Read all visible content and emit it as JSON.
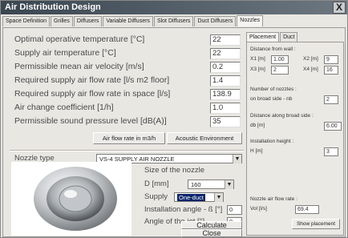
{
  "window": {
    "title": "Air Distribution Design",
    "close_label": "X"
  },
  "tabs": [
    {
      "label": "Space Definition"
    },
    {
      "label": "Grilles"
    },
    {
      "label": "Diffusers"
    },
    {
      "label": "Variable Diffusers"
    },
    {
      "label": "Slot Diffusers"
    },
    {
      "label": "Duct Diffusers"
    },
    {
      "label": "Nozzles",
      "active": true
    }
  ],
  "params": [
    {
      "label": "Optimal operative temperature  [°C]",
      "value": "22"
    },
    {
      "label": "Supply air temperature  [°C]",
      "value": "22"
    },
    {
      "label": "Permissible mean air velocity  [m/s]",
      "value": "0.2"
    },
    {
      "label": "Required supply air flow rate  [l/s m2 floor]",
      "value": "1.4"
    },
    {
      "label": "Required supply air flow rate in space  [l/s]",
      "value": "138.9"
    },
    {
      "label": "Air change coefficient  [1/h]",
      "value": "1.0"
    },
    {
      "label": "Permissible sound pressure level  [dB(A)]",
      "value": "35"
    }
  ],
  "buttons": {
    "airflow": "Air flow rate in m3/h",
    "acoustic": "Acoustic Environment",
    "calculate": "Calculate",
    "close": "Close",
    "show_placement": "Show placement"
  },
  "nozzle_type": {
    "label": "Nozzle type",
    "value": "VS-4  SUPPLY AIR NOZZLE"
  },
  "size": {
    "title": "Size of the nozzle",
    "d_label": "D   [mm]",
    "d_value": "160",
    "supply_label": "Supply",
    "supply_value": "One-duct",
    "angle_label": "Installation angle - ß   [°]",
    "angle_value": "0",
    "jet_label": "Angle of the jet  [°]",
    "jet_value": "0"
  },
  "right": {
    "tabs": [
      "Placement",
      "Duct"
    ],
    "distance_wall": "Distance from wall :",
    "x1_label": "X1  [m]",
    "x1_value": "1.00",
    "x2_label": "X2  [m]",
    "x2_value": "9",
    "x3_label": "X3  [m]",
    "x3_value": "2",
    "x4_label": "X4  [m]",
    "x4_value": "16",
    "num_nozzles": "Number of nozzles :",
    "broad_side_label": "on broad side - nb",
    "broad_side_value": "2",
    "dist_along": "Distance along broad side :",
    "db_label": "db  [m]",
    "db_value": "6.00",
    "inst_height": "Installation height :",
    "h_label": "H  [m]",
    "h_value": "3",
    "flow_rate": "Nozzle air flow rate :",
    "vol_label": "Vol  [l/s]",
    "vol_value": "69.4"
  },
  "colors": {
    "titlebar": "#3a4650",
    "panel": "#e9e7e2",
    "highlight": "#0a246a"
  }
}
